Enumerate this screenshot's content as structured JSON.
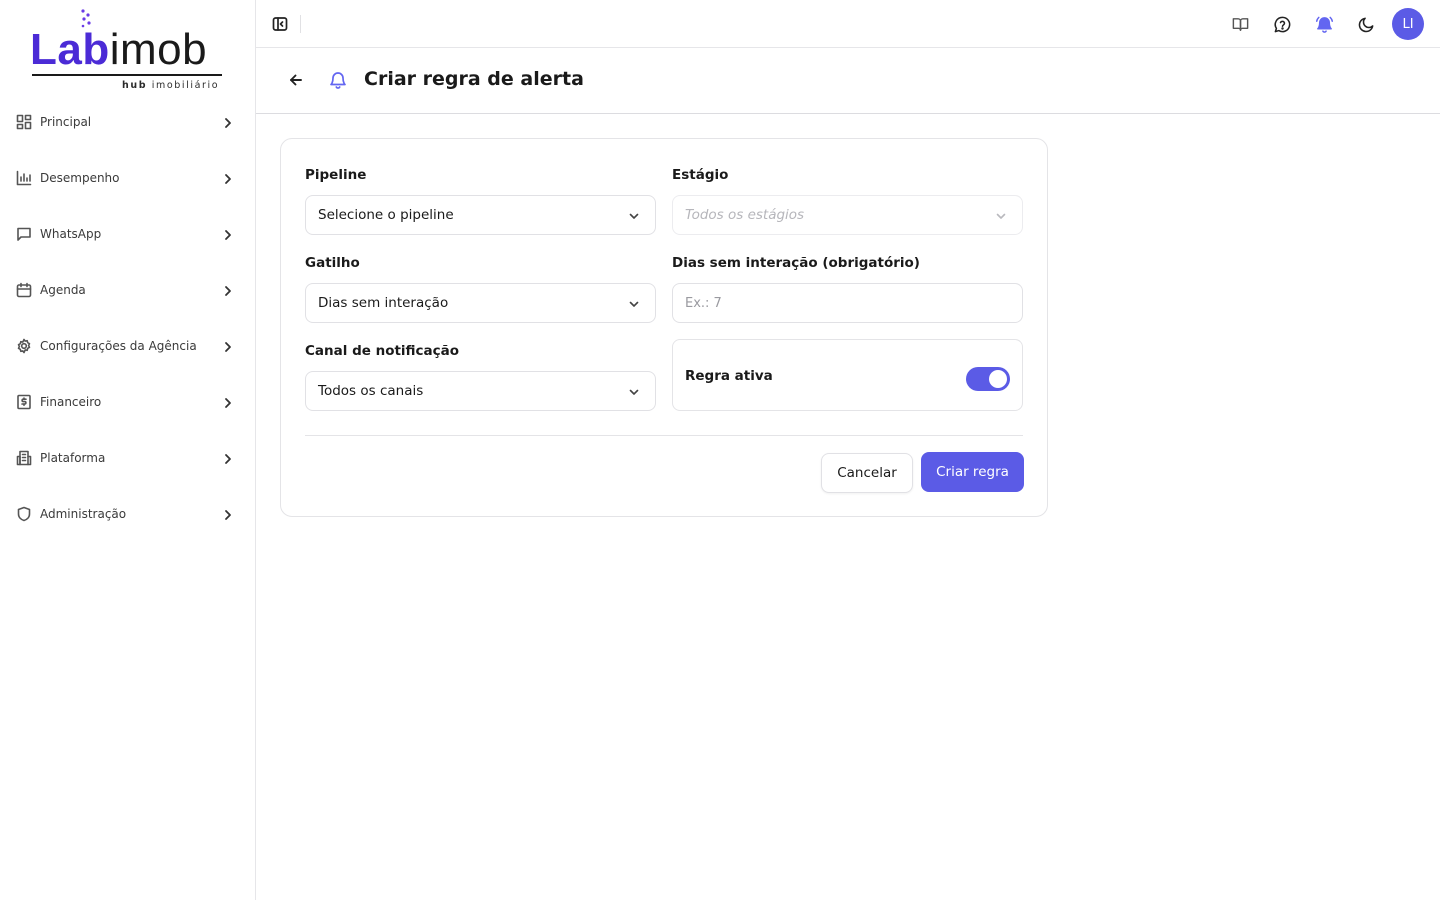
{
  "brand": {
    "name_colored": "Lab",
    "name_plain": "imob",
    "tagline_bold": "hub",
    "tagline_rest": "imobiliário",
    "accent_color": "#4b2bd6"
  },
  "sidebar": {
    "items": [
      {
        "label": "Principal",
        "icon": "grid-icon"
      },
      {
        "label": "Desempenho",
        "icon": "bar-chart-icon"
      },
      {
        "label": "WhatsApp",
        "icon": "message-icon"
      },
      {
        "label": "Agenda",
        "icon": "calendar-icon"
      },
      {
        "label": "Configurações da Agência",
        "icon": "gear-icon"
      },
      {
        "label": "Financeiro",
        "icon": "dollar-receipt-icon"
      },
      {
        "label": "Plataforma",
        "icon": "building-icon"
      },
      {
        "label": "Administração",
        "icon": "shield-icon"
      }
    ]
  },
  "topbar": {
    "icons": [
      "book-open-icon",
      "help-chat-icon",
      "bell-ringing-icon",
      "moon-icon"
    ],
    "avatar_initials": "LI",
    "accent_color": "#5b5be6"
  },
  "header": {
    "title": "Criar regra de alerta"
  },
  "form": {
    "pipeline": {
      "label": "Pipeline",
      "value": "Selecione o pipeline"
    },
    "stage": {
      "label": "Estágio",
      "value": "Todos os estágios",
      "disabled": true
    },
    "trigger": {
      "label": "Gatilho",
      "value": "Dias sem interação"
    },
    "days": {
      "label": "Dias sem interação (obrigatório)",
      "placeholder": "Ex.: 7",
      "value": ""
    },
    "channel": {
      "label": "Canal de notificação",
      "value": "Todos os canais"
    },
    "active": {
      "label": "Regra ativa",
      "checked": true
    },
    "cancel_label": "Cancelar",
    "submit_label": "Criar regra",
    "primary_color": "#5b5be6"
  }
}
